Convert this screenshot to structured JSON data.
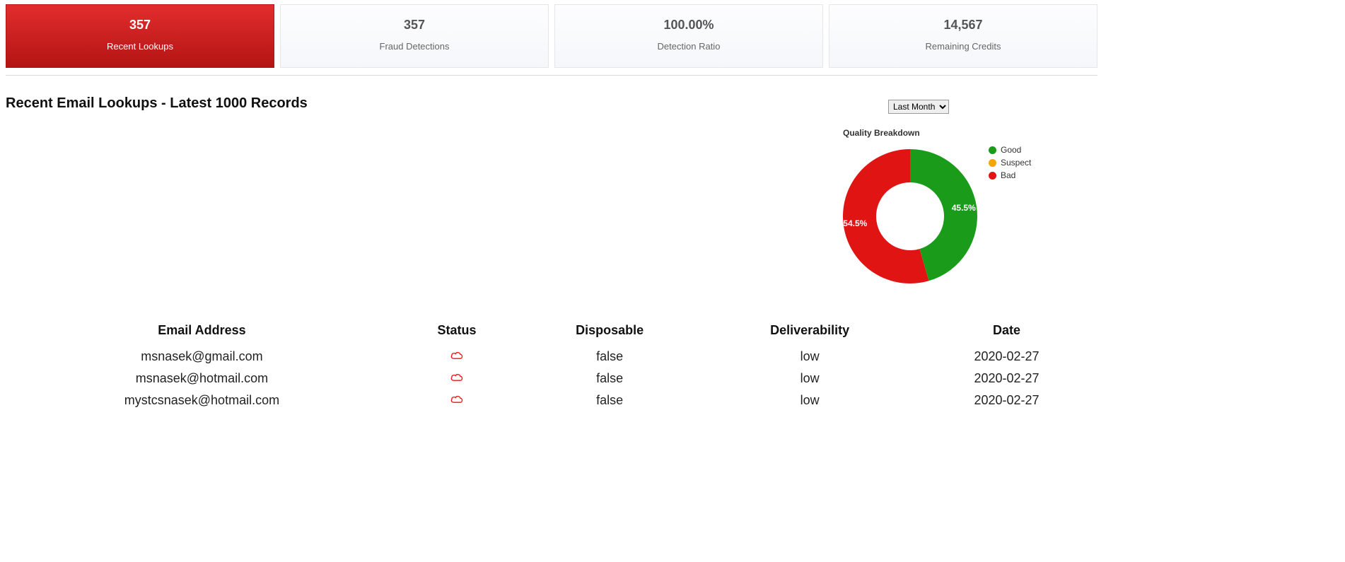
{
  "cards": [
    {
      "value": "357",
      "label": "Recent Lookups",
      "active": true
    },
    {
      "value": "357",
      "label": "Fraud Detections",
      "active": false
    },
    {
      "value": "100.00%",
      "label": "Detection Ratio",
      "active": false
    },
    {
      "value": "14,567",
      "label": "Remaining Credits",
      "active": false
    }
  ],
  "section_title": "Recent Email Lookups - Latest 1000 Records",
  "range": {
    "selected": "Last Month",
    "options": [
      "Last Month"
    ]
  },
  "chart_data": {
    "type": "pie",
    "title": "Quality Breakdown",
    "series": [
      {
        "name": "Good",
        "value": 45.5,
        "color": "#1a9b1a"
      },
      {
        "name": "Suspect",
        "value": 0.0,
        "color": "#f6a509"
      },
      {
        "name": "Bad",
        "value": 54.5,
        "color": "#e11414"
      }
    ],
    "labels_shown": [
      "45.5%",
      "54.5%"
    ]
  },
  "table": {
    "headers": [
      "Email Address",
      "Status",
      "Disposable",
      "Deliverability",
      "Date"
    ],
    "rows": [
      {
        "email": "msnasek@gmail.com",
        "status_icon": "cloud-alert-icon",
        "disposable": "false",
        "deliverability": "low",
        "date": "2020-02-27"
      },
      {
        "email": "msnasek@hotmail.com",
        "status_icon": "cloud-alert-icon",
        "disposable": "false",
        "deliverability": "low",
        "date": "2020-02-27"
      },
      {
        "email": "mystcsnasek@hotmail.com",
        "status_icon": "cloud-alert-icon",
        "disposable": "false",
        "deliverability": "low",
        "date": "2020-02-27"
      }
    ]
  }
}
